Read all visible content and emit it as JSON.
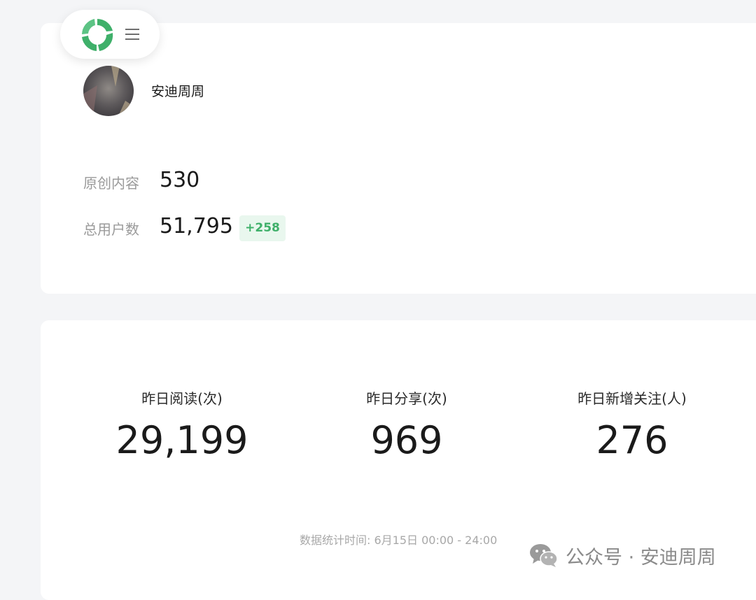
{
  "header": {
    "logo_icon": "wechat-mp-logo-icon",
    "menu_icon": "hamburger-menu-icon"
  },
  "profile": {
    "account_name": "安迪周周",
    "original_content_label": "原创内容",
    "original_content_value": "530",
    "total_users_label": "总用户数",
    "total_users_value": "51,795",
    "total_users_delta": "+258"
  },
  "stats": {
    "metrics": [
      {
        "label": "昨日阅读(次)",
        "value": "29,199"
      },
      {
        "label": "昨日分享(次)",
        "value": "969"
      },
      {
        "label": "昨日新增关注(人)",
        "value": "276"
      }
    ],
    "timestamp": "数据统计时间: 6月15日 00:00 - 24:00"
  },
  "watermark": {
    "icon": "wechat-icon",
    "text": "公众号 · 安迪周周"
  },
  "colors": {
    "accent_green": "#3fb06a",
    "badge_bg": "#e9f7ee",
    "page_bg": "#f4f5f7"
  }
}
